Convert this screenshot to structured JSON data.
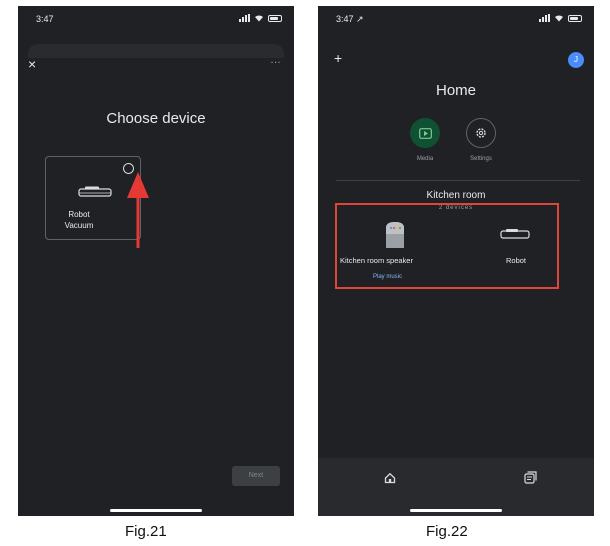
{
  "fig21": {
    "status_time": "3:47",
    "close_glyph": "×",
    "more_glyph": "…",
    "title": "Choose device",
    "device_card": {
      "line1": "Robot",
      "line2": "Vacuum",
      "selected": false
    },
    "next_label": "Next",
    "caption": "Fig.21",
    "annotation_color": "#e53935"
  },
  "fig22": {
    "status_time": "3:47 ↗",
    "plus_glyph": "+",
    "avatar_initial": "J",
    "title": "Home",
    "chips": [
      {
        "label": "Media",
        "icon": "media-play-icon"
      },
      {
        "label": "Settings",
        "icon": "gear-icon"
      }
    ],
    "room_title": "Kitchen room",
    "room_subtitle": "2 devices",
    "devices": [
      {
        "label": "Kitchen room speaker",
        "action": "Play music",
        "icon": "smart-speaker-icon"
      },
      {
        "label": "Robot",
        "icon": "robot-vacuum-icon"
      }
    ],
    "nav": [
      "home-icon",
      "feed-icon"
    ],
    "caption": "Fig.22",
    "highlight_color": "#e0453a",
    "accent_color": "#8ab4f8"
  }
}
